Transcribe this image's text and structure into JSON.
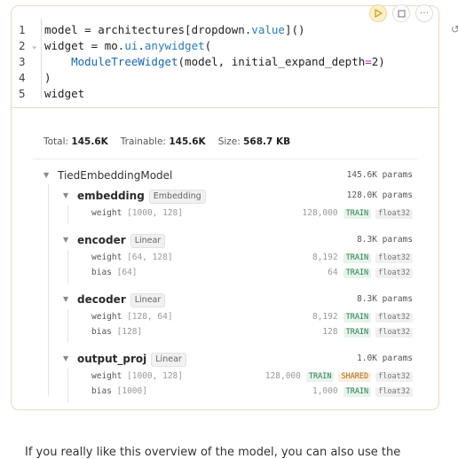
{
  "code": {
    "line_numbers": [
      "1",
      "2",
      "3",
      "4",
      "5"
    ],
    "lines": [
      {
        "segments": [
          {
            "t": "model = architectures[dropdown.",
            "c": ""
          },
          {
            "t": "value",
            "c": "tok-attr"
          },
          {
            "t": "]()",
            "c": ""
          }
        ]
      },
      {
        "segments": [
          {
            "t": "widget = mo.",
            "c": ""
          },
          {
            "t": "ui",
            "c": "tok-attr"
          },
          {
            "t": ".",
            "c": ""
          },
          {
            "t": "anywidget",
            "c": "tok-attr"
          },
          {
            "t": "(",
            "c": ""
          }
        ]
      },
      {
        "segments": [
          {
            "t": "    ",
            "c": ""
          },
          {
            "t": "ModuleTreeWidget",
            "c": "tok-fn"
          },
          {
            "t": "(model, initial_expand_depth",
            "c": ""
          },
          {
            "t": "=",
            "c": "tok-kw"
          },
          {
            "t": "2)",
            "c": ""
          }
        ]
      },
      {
        "segments": [
          {
            "t": ")",
            "c": ""
          }
        ]
      },
      {
        "segments": [
          {
            "t": "widget",
            "c": ""
          }
        ]
      }
    ]
  },
  "controls": {
    "run_icon": "play-icon",
    "stop_icon": "stop-icon",
    "more_icon": "more-icon"
  },
  "stats": {
    "total_label": "Total:",
    "total_value": "145.6K",
    "trainable_label": "Trainable:",
    "trainable_value": "145.6K",
    "size_label": "Size:",
    "size_value": "568.7 KB"
  },
  "tree": {
    "root": {
      "name": "TiedEmbeddingModel",
      "params": "145.6K params"
    },
    "modules": [
      {
        "name": "embedding",
        "type": "Embedding",
        "params": "128.0K params",
        "parameters": [
          {
            "name": "weight",
            "shape": "[1000, 128]",
            "count": "128,000",
            "tags": [
              "TRAIN",
              "float32"
            ]
          }
        ]
      },
      {
        "name": "encoder",
        "type": "Linear",
        "params": "8.3K params",
        "parameters": [
          {
            "name": "weight",
            "shape": "[64, 128]",
            "count": "8,192",
            "tags": [
              "TRAIN",
              "float32"
            ]
          },
          {
            "name": "bias",
            "shape": "[64]",
            "count": "64",
            "tags": [
              "TRAIN",
              "float32"
            ]
          }
        ]
      },
      {
        "name": "decoder",
        "type": "Linear",
        "params": "8.3K params",
        "parameters": [
          {
            "name": "weight",
            "shape": "[128, 64]",
            "count": "8,192",
            "tags": [
              "TRAIN",
              "float32"
            ]
          },
          {
            "name": "bias",
            "shape": "[128]",
            "count": "128",
            "tags": [
              "TRAIN",
              "float32"
            ]
          }
        ]
      },
      {
        "name": "output_proj",
        "type": "Linear",
        "params": "1.0K params",
        "parameters": [
          {
            "name": "weight",
            "shape": "[1000, 128]",
            "count": "128,000",
            "tags": [
              "TRAIN",
              "SHARED",
              "float32"
            ]
          },
          {
            "name": "bias",
            "shape": "[1000]",
            "count": "1,000",
            "tags": [
              "TRAIN",
              "float32"
            ]
          }
        ]
      }
    ]
  },
  "footer_text": "If you really like this overview of the model, you can also use the"
}
